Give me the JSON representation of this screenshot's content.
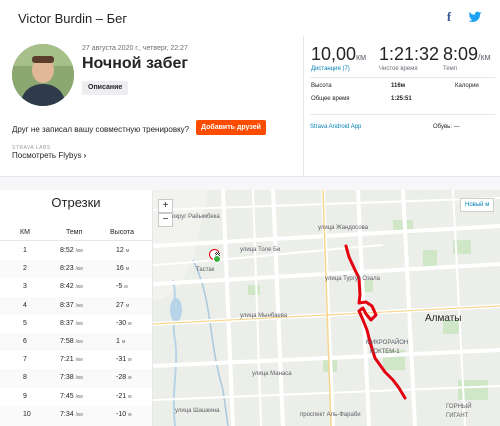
{
  "header": {
    "title": "Victor Burdin – Бег",
    "facebook_icon": "f",
    "twitter_icon": "twitter-bird"
  },
  "activity": {
    "date": "27 августа 2020 г., четверг, 22:27",
    "title": "Ночной забег",
    "description_badge": "Описание",
    "friend_question": "Друг не записал вашу совместную тренировку?",
    "add_friends_button": "Добавить друзей",
    "labs_label": "STRAVA LABS",
    "flyby_link": "Посмотреть Flybys",
    "flyby_chevron": "›"
  },
  "stats": {
    "distance_value": "10,00",
    "distance_unit": "км",
    "distance_label": "Дистанция (7)",
    "time_value": "1:21:32",
    "time_label": "Чистое время",
    "pace_value": "8:09",
    "pace_unit": "/км",
    "pace_label": "Темп",
    "elevation_label": "Высота",
    "elevation_value": "116м",
    "calories_label": "Калории",
    "total_time_label": "Общее время",
    "total_time_value": "1:25:51",
    "device": "Strava Android App",
    "shoes_label": "Обувь: —"
  },
  "splits": {
    "title": "Отрезки",
    "columns": [
      "КМ",
      "Темп",
      "Высота"
    ],
    "pace_unit": "/км",
    "elev_unit": "м",
    "rows": [
      {
        "km": "1",
        "pace": "8:52",
        "elev": "12"
      },
      {
        "km": "2",
        "pace": "8:23",
        "elev": "16"
      },
      {
        "km": "3",
        "pace": "8:42",
        "elev": "-5"
      },
      {
        "km": "4",
        "pace": "8:37",
        "elev": "27"
      },
      {
        "km": "5",
        "pace": "8:37",
        "elev": "-30"
      },
      {
        "km": "6",
        "pace": "7:58",
        "elev": "1"
      },
      {
        "km": "7",
        "pace": "7:21",
        "elev": "-31"
      },
      {
        "km": "8",
        "pace": "7:38",
        "elev": "-28"
      },
      {
        "km": "9",
        "pace": "7:45",
        "elev": "-21"
      },
      {
        "km": "10",
        "pace": "7:34",
        "elev": "-10"
      }
    ]
  },
  "map": {
    "zoom_in": "+",
    "zoom_out": "−",
    "new_map_button": "Новый м",
    "city_label": "Алматы",
    "labels": {
      "district": "округ Райымбека",
      "tole_bi": "улица Толе Би",
      "tastak": "Тастак",
      "mynbaev": "улица Мынбаева",
      "manasa": "улица Манаса",
      "zhandosova": "улица Жандосова",
      "shashkina": "улица Шашкина",
      "mikro1": "МИКРОРАЙОН",
      "mikro2": "КОКТЕМ-1",
      "gorny1": "ГОРНЫЙ",
      "gorny2": "ГИГАНТ",
      "tergulbaeva": "улица Тургут Озала",
      "prospekt": "проспект Аль-Фараби"
    },
    "route_color": "#e3000f",
    "start_color": "#3cb043"
  }
}
